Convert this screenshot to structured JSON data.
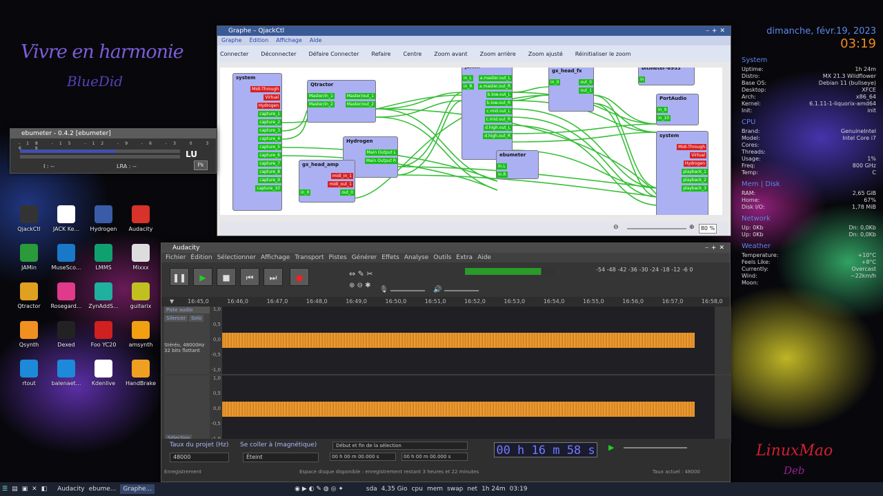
{
  "desktop": {
    "title": "Vivre en harmonie",
    "subtitle": "BlueDid",
    "icons": [
      {
        "label": "QjackCtl",
        "color": "#333333"
      },
      {
        "label": "JACK Ke...",
        "color": "#ffffff"
      },
      {
        "label": "Hydrogen",
        "color": "#3a5ba8"
      },
      {
        "label": "Audacity",
        "color": "#d8322a"
      },
      {
        "label": "JAMin",
        "color": "#2a9a3a"
      },
      {
        "label": "MuseSco...",
        "color": "#1a78c8"
      },
      {
        "label": "LMMS",
        "color": "#10a070"
      },
      {
        "label": "Mixxx",
        "color": "#dddddd"
      },
      {
        "label": "Qtractor",
        "color": "#e0a020"
      },
      {
        "label": "Rosegard...",
        "color": "#e03a8a"
      },
      {
        "label": "ZynAddS...",
        "color": "#20b0a0"
      },
      {
        "label": "guitarix",
        "color": "#c0c020"
      },
      {
        "label": "Qsynth",
        "color": "#f09020"
      },
      {
        "label": "Dexed",
        "color": "#222222"
      },
      {
        "label": "Foo YC20",
        "color": "#d02020"
      },
      {
        "label": "amsynth",
        "color": "#f0a010"
      },
      {
        "label": "rtout",
        "color": "#1c8ad8"
      },
      {
        "label": "balenaet...",
        "color": "#1c8ad8"
      },
      {
        "label": "Kdenlive",
        "color": "#ffffff"
      },
      {
        "label": "HandBrake",
        "color": "#f0a020"
      }
    ],
    "signature_1": "LinuxMao",
    "signature_2": "Deb"
  },
  "conky": {
    "date": "dimanche, févr.19, 2023",
    "time": "03:19",
    "system_header": "System",
    "system_rows": [
      [
        "Uptime:",
        "1h 24m"
      ],
      [
        "Distro:",
        "MX 21.3 Wildflower"
      ],
      [
        "Base OS:",
        "Debian 11 (bullseye)"
      ],
      [
        "Desktop:",
        "XFCE"
      ],
      [
        "Arch:",
        "x86_64"
      ],
      [
        "Kernel:",
        "6.1.11-1-liquorix-amd64"
      ],
      [
        "Init:",
        "init"
      ]
    ],
    "cpu_header": "CPU",
    "cpu_rows": [
      [
        "Brand:",
        "GenuineIntel"
      ],
      [
        "Model:",
        "Intel Core i7"
      ],
      [
        "Cores:",
        ""
      ],
      [
        "Threads:",
        ""
      ],
      [
        "Usage:",
        "1%"
      ],
      [
        "Freq:",
        "800 GHz"
      ],
      [
        "Temp:",
        "C"
      ]
    ],
    "mem_header": "Mem | Disk",
    "mem_rows": [
      [
        "RAM:",
        "2,65 GiB"
      ],
      [
        "Home:",
        "67%"
      ],
      [
        "Disk I/O:",
        "1,78 MiB"
      ]
    ],
    "net_header": "Network",
    "net_rows": [
      [
        "Up: 0Kb",
        "Dn: 0,0Kb"
      ],
      [
        "Up: 0Kb",
        "Dn: 0,0Kb"
      ]
    ],
    "weather_header": "Weather",
    "weather_rows": [
      [
        "Temperature:",
        "+10°C"
      ],
      [
        "Feels Like:",
        "+8°C"
      ],
      [
        "Currently:",
        "Overcast"
      ],
      [
        "Wind:",
        "~22km/h"
      ],
      [
        "Moon:",
        ""
      ]
    ]
  },
  "qjackctl": {
    "title": "Graphe – QjackCtl",
    "menu": [
      "Graphe",
      "Édition",
      "Affichage",
      "Aide"
    ],
    "toolbar": [
      "Connecter",
      "Déconnecter",
      "Défaire Connecter",
      "Refaire",
      "Centre",
      "Zoom avant",
      "Zoom arrière",
      "Zoom ajusté",
      "Réinitialiser le zoom"
    ],
    "zoom": "80 %",
    "nodes": {
      "system_in": {
        "title": "system",
        "red": [
          "Midi-Through",
          "Virtual",
          "Hydrogen"
        ],
        "green": [
          "capture_1",
          "capture_2",
          "capture_3",
          "capture_4",
          "capture_5",
          "capture_6",
          "capture_7",
          "capture_8",
          "capture_9",
          "capture_10"
        ]
      },
      "qtractor": {
        "title": "Qtractor",
        "in": [
          "Master/in_1",
          "Master/in_2"
        ],
        "out": [
          "Master/out_1",
          "Master/out_2"
        ]
      },
      "hydrogen": {
        "title": "Hydrogen",
        "out": [
          "Main Output L",
          "Main Output R"
        ]
      },
      "gx_head_amp": {
        "title": "gx_head_amp",
        "red": [
          "midi_in_1",
          "midi_out_1"
        ],
        "in": [
          "in_0"
        ],
        "out": [
          "out_0"
        ]
      },
      "jamin": {
        "title": "jamin",
        "in": [
          "in_L",
          "in_R"
        ],
        "out": [
          "a.master.out_L",
          "a.master.out_R",
          "b.low.out_L",
          "b.low.out_R",
          "c.mid.out_L",
          "c.mid.out_R",
          "d.high.out_L",
          "d.high.out_R"
        ]
      },
      "gx_head_fx": {
        "title": "gx_head_fx",
        "in": [
          "in_0"
        ],
        "out": [
          "out_0",
          "out_1"
        ]
      },
      "ebumeter": {
        "title": "ebumeter",
        "in": [
          "in.L",
          "in.R"
        ]
      },
      "bitmeter": {
        "title": "bitmeter-6953",
        "in": [
          "in"
        ]
      },
      "portaudio": {
        "title": "PortAudio",
        "in": [
          "in_9",
          "in_10"
        ]
      },
      "system_out": {
        "title": "system",
        "red": [
          "Midi-Through",
          "Virtual",
          "Hydrogen"
        ],
        "green": [
          "playback_1",
          "playback_2",
          "playback_3"
        ]
      }
    }
  },
  "ebumeter": {
    "title": "ebumeter - 0.4.2 [ebumeter]",
    "scale": [
      "-18",
      "-15",
      "-12",
      "-9",
      "-6",
      "-3",
      "0",
      "3",
      "6",
      "9"
    ],
    "unit": "LU",
    "i_label": "I : --",
    "lra_label": "LRA : --",
    "pk_button": "Pk"
  },
  "audacity": {
    "title": "Audacity",
    "menu": [
      "Fichier",
      "Édition",
      "Sélectionner",
      "Affichage",
      "Transport",
      "Pistes",
      "Générer",
      "Effets",
      "Analyse",
      "Outils",
      "Extra",
      "Aide"
    ],
    "ruler": [
      "16:45,0",
      "16:46,0",
      "16:47,0",
      "16:48,0",
      "16:49,0",
      "16:50,0",
      "16:51,0",
      "16:52,0",
      "16:53,0",
      "16:54,0",
      "16:55,0",
      "16:56,0",
      "16:57,0",
      "16:58,0"
    ],
    "meter_scale": "-54 -48 -42 -36 -30 -24 -18 -12 -6 0",
    "track": {
      "name": "Piste audio",
      "silence": "Silencer",
      "solo": "Solo",
      "info_1": "Stéréo, 48000Hz",
      "info_2": "32 bits flottant",
      "select": "Sélection"
    },
    "scale_values": [
      "1,0",
      "0,5",
      "0,0",
      "-0,5",
      "-1,0"
    ],
    "rate_label": "Taux du projet (Hz)",
    "snap_label": "Se coller à (magnétique)",
    "rate_value": "48000",
    "snap_value": "Éteint",
    "selection_label": "Début et fin de la sélection",
    "sel_start": "00 h 00 m 00.000 s",
    "sel_end": "00 h 00 m 00.000 s",
    "time": "00 h 16 m 58 s",
    "status_left": "Enregistrement",
    "status_mid": "Espace disque disponible : enregistrement restant 3 heures et 22 minutes",
    "status_right": "Taux actuel : 48000"
  },
  "taskbar": {
    "items": [
      "Audacity",
      "ebume...",
      "Graphe..."
    ],
    "right": [
      "sda",
      "4,35 Gio",
      "cpu",
      "mem",
      "swap",
      "net",
      "1h 24m",
      "03:19"
    ]
  }
}
